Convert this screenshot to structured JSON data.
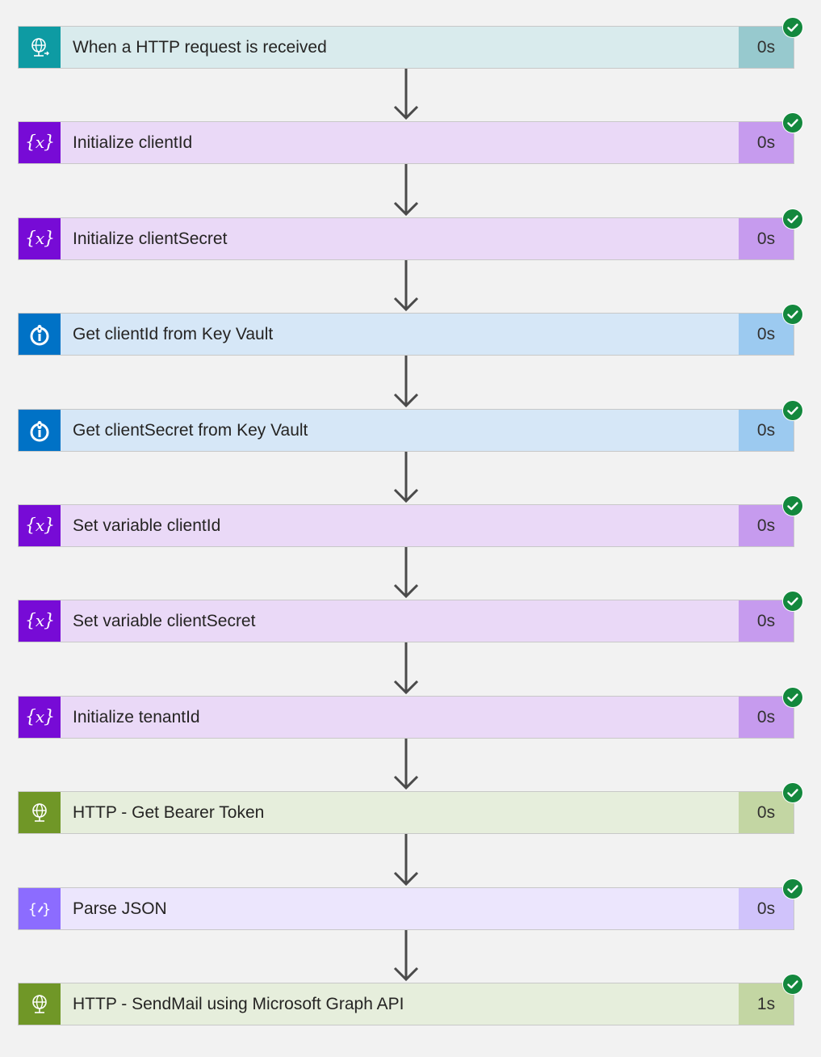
{
  "steps": [
    {
      "label": "When a HTTP request is received",
      "duration": "0s",
      "icon": "http-request-icon",
      "theme": {
        "icon_bg": "#0e9ba3",
        "body_bg": "#d9ebed",
        "dur_bg": "#97c9ce"
      }
    },
    {
      "label": "Initialize clientId",
      "duration": "0s",
      "icon": "variable-icon",
      "theme": {
        "icon_bg": "#770bd6",
        "body_bg": "#ead9f7",
        "dur_bg": "#c69bee"
      }
    },
    {
      "label": "Initialize clientSecret",
      "duration": "0s",
      "icon": "variable-icon",
      "theme": {
        "icon_bg": "#770bd6",
        "body_bg": "#ead9f7",
        "dur_bg": "#c69bee"
      }
    },
    {
      "label": "Get clientId from Key Vault",
      "duration": "0s",
      "icon": "key-vault-icon",
      "theme": {
        "icon_bg": "#0072c6",
        "body_bg": "#d6e7f7",
        "dur_bg": "#9ccaf0"
      }
    },
    {
      "label": "Get clientSecret from Key Vault",
      "duration": "0s",
      "icon": "key-vault-icon",
      "theme": {
        "icon_bg": "#0072c6",
        "body_bg": "#d6e7f7",
        "dur_bg": "#9ccaf0"
      }
    },
    {
      "label": "Set variable clientId",
      "duration": "0s",
      "icon": "variable-icon",
      "theme": {
        "icon_bg": "#770bd6",
        "body_bg": "#ead9f7",
        "dur_bg": "#c69bee"
      }
    },
    {
      "label": "Set variable clientSecret",
      "duration": "0s",
      "icon": "variable-icon",
      "theme": {
        "icon_bg": "#770bd6",
        "body_bg": "#ead9f7",
        "dur_bg": "#c69bee"
      }
    },
    {
      "label": "Initialize tenantId",
      "duration": "0s",
      "icon": "variable-icon",
      "theme": {
        "icon_bg": "#770bd6",
        "body_bg": "#ead9f7",
        "dur_bg": "#c69bee"
      }
    },
    {
      "label": "HTTP - Get Bearer Token",
      "duration": "0s",
      "icon": "http-globe-icon",
      "theme": {
        "icon_bg": "#709727",
        "body_bg": "#e6eedc",
        "dur_bg": "#c3d6a3"
      }
    },
    {
      "label": "Parse JSON",
      "duration": "0s",
      "icon": "parse-json-icon",
      "theme": {
        "icon_bg": "#8c6cff",
        "body_bg": "#ece6fd",
        "dur_bg": "#d0c3fb"
      }
    },
    {
      "label": "HTTP - SendMail using Microsoft Graph API",
      "duration": "1s",
      "icon": "http-globe-icon",
      "theme": {
        "icon_bg": "#709727",
        "body_bg": "#e6eedc",
        "dur_bg": "#c3d6a3"
      }
    }
  ],
  "status": {
    "icon": "success-check-icon",
    "color": "#13883d"
  },
  "connector": {
    "icon": "arrow-down-icon",
    "color": "#4a4a4a"
  }
}
